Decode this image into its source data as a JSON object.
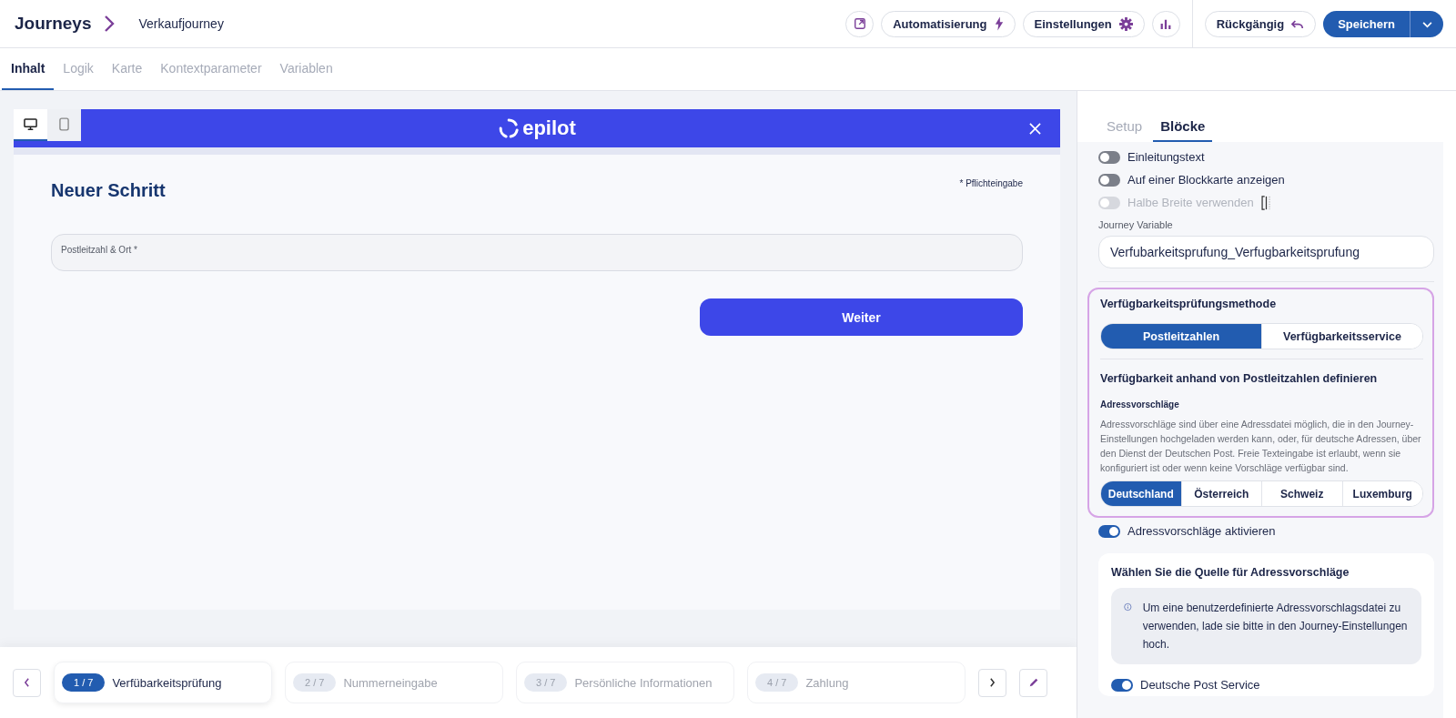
{
  "header": {
    "breadcrumb_root": "Journeys",
    "title": "Verkaufjourney",
    "toolbar_buttons": [
      {
        "kind": "open"
      },
      {
        "kind": "automation",
        "label": "Automatisierung"
      },
      {
        "kind": "settings",
        "label": "Einstellungen"
      },
      {
        "kind": "analytics"
      }
    ],
    "undo_button": "Rückgängig",
    "save_button": "Speichern"
  },
  "tabs": [
    {
      "label": "Inhalt",
      "selected": true
    },
    {
      "label": "Logik",
      "selected": false
    },
    {
      "label": "Karte",
      "selected": false
    },
    {
      "label": "Kontextparameter",
      "selected": false
    },
    {
      "label": "Variablen",
      "selected": false
    }
  ],
  "preview": {
    "devices": [
      {
        "kind": "desktop",
        "selected": true
      },
      {
        "kind": "mobile",
        "selected": false
      }
    ],
    "logo": "epilot",
    "step_title": "Neuer Schritt",
    "required_note": "* Pflichteingabe",
    "field_label": "Postleitzahl & Ort *",
    "next_button": "Weiter"
  },
  "steps": [
    {
      "number": "1 / 7",
      "label": "Verfübarkeitsprüfung",
      "selected": true
    },
    {
      "number": "2 / 7",
      "label": "Nummerneingabe",
      "selected": false
    },
    {
      "number": "3 / 7",
      "label": "Persönliche Informationen",
      "selected": false
    },
    {
      "number": "4 / 7",
      "label": "Zahlung",
      "selected": false
    }
  ],
  "panel": {
    "tabs": [
      {
        "label": "Setup",
        "selected": false
      },
      {
        "label": "Blöcke",
        "selected": true
      }
    ],
    "toggles": [
      {
        "label": "Einleitungstext",
        "on": false,
        "disabled": false
      },
      {
        "label": "Auf einer Blockkarte anzeigen",
        "on": false,
        "disabled": false
      },
      {
        "label": "Halbe Breite verwenden",
        "on": false,
        "disabled": true
      }
    ],
    "variable_label": "Journey Variable",
    "variable_value": "Verfubarkeitsprufung_Verfugbarkeitsprufung",
    "method": {
      "title": "Verfügbarkeitsprüfungsmethode",
      "options": [
        {
          "label": "Postleitzahlen",
          "selected": true
        },
        {
          "label": "Verfügbarkeitsservice",
          "selected": false
        }
      ],
      "define_title": "Verfügbarkeit anhand von Postleitzahlen definieren",
      "suggestions_title": "Adressvorschläge",
      "description": "Adressvorschläge sind über eine Adressdatei möglich, die in den Journey-Einstellungen hochgeladen werden kann, oder, für deutsche Adressen, über den Dienst der Deutschen Post. Freie Texteingabe ist erlaubt, wenn sie konfiguriert ist oder wenn keine Vorschläge verfügbar sind.",
      "countries": [
        {
          "label": "Deutschland",
          "selected": true
        },
        {
          "label": "Österreich",
          "selected": false
        },
        {
          "label": "Schweiz",
          "selected": false
        },
        {
          "label": "Luxemburg",
          "selected": false
        }
      ]
    },
    "suggestions_toggle": {
      "label": "Adressvorschläge aktivieren",
      "on": true
    },
    "source": {
      "title": "Wählen Sie die Quelle für Adressvorschläge",
      "info": "Um eine benutzerdefinierte Adressvorschlagsdatei zu verwenden, lade sie bitte in den Journey-Einstellungen hoch.",
      "service_toggle": {
        "label": "Deutsche Post Service",
        "on": true
      }
    }
  }
}
